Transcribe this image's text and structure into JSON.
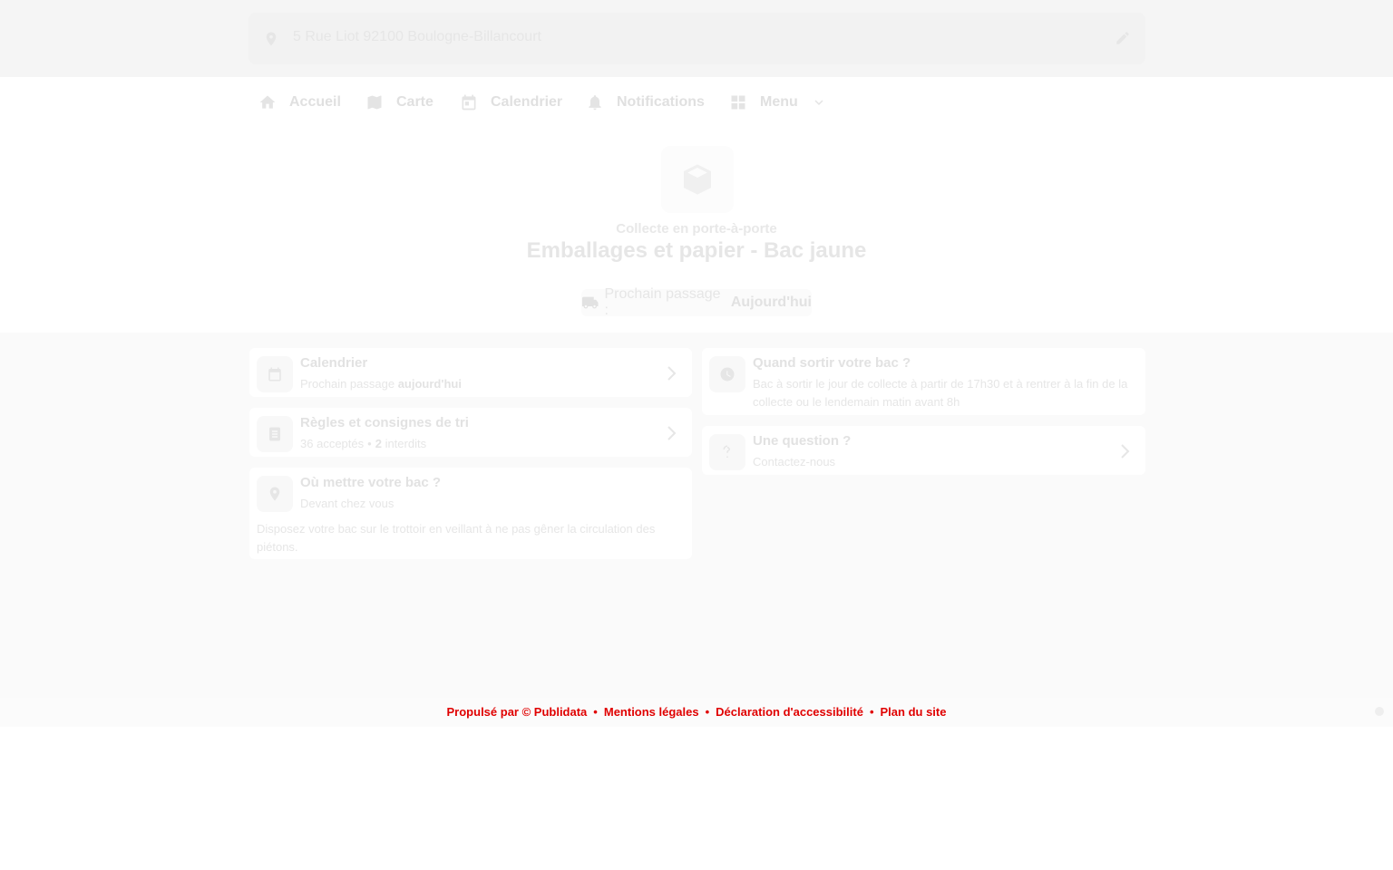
{
  "address": {
    "text": "5 Rue Liot 92100 Boulogne-Billancourt",
    "pin_icon": "map-pin-icon",
    "edit_icon": "pencil-icon"
  },
  "nav": {
    "items": [
      {
        "label": "Accueil",
        "icon": "home-icon"
      },
      {
        "label": "Carte",
        "icon": "map-icon"
      },
      {
        "label": "Calendrier",
        "icon": "calendar-icon"
      },
      {
        "label": "Notifications",
        "icon": "bell-icon"
      },
      {
        "label": "Menu",
        "icon": "grid-icon"
      }
    ]
  },
  "hero": {
    "icon": "box-icon",
    "subtitle": "Collecte en porte-à-porte",
    "title": "Emballages et papier - Bac jaune",
    "next_label": "Prochain passage :",
    "next_value": "Aujourd'hui"
  },
  "cards": {
    "calendar": {
      "title": "Calendrier",
      "sub_prefix": "Prochain passage",
      "sub_value": "aujourd'hui"
    },
    "rules": {
      "title": "Règles et consignes de tri",
      "accepted_count": "36",
      "accepted_label": "acceptés",
      "forbidden_count": "2",
      "forbidden_label": "interdits"
    },
    "where": {
      "title": "Où mettre votre bac ?",
      "sub": "Devant chez vous",
      "body": "Disposez votre bac sur le trottoir en veillant à ne pas gêner la circulation des piétons."
    },
    "when": {
      "title": "Quand sortir votre bac ?",
      "sub": "Bac à sortir le jour de collecte à partir de 17h30 et à rentrer à la fin de la collecte ou le lendemain matin avant 8h"
    },
    "question": {
      "title": "Une question ?",
      "sub": "Contactez-nous"
    }
  },
  "footer": {
    "links": [
      "Propulsé par © Publidata",
      "Mentions légales",
      "Déclaration d'accessibilité",
      "Plan du site"
    ]
  },
  "colors": {
    "footer_link": "#e00000",
    "page_bg": "#fafafa"
  }
}
